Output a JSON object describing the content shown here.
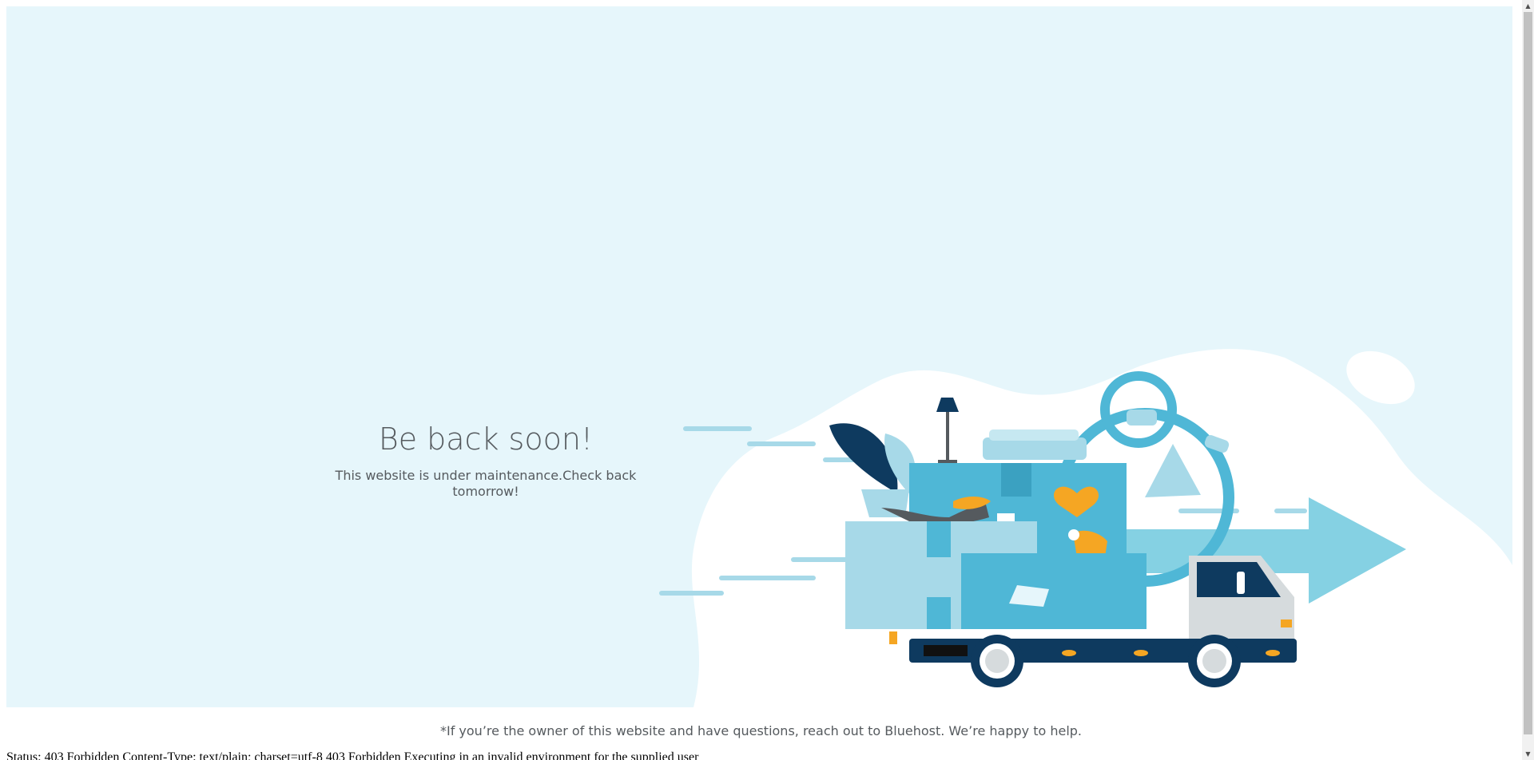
{
  "hero": {
    "title": "Be back soon!",
    "subtitle": "This website is under maintenance.Check back tomorrow!"
  },
  "footer": {
    "note": "*If you’re the owner of this website and have questions, reach out to Bluehost. We’re happy to help."
  },
  "status": {
    "text": "Status: 403 Forbidden Content-Type: text/plain; charset=utf-8 403 Forbidden Executing in an invalid environment for the supplied user"
  },
  "colors": {
    "hero_bg": "#e6f6fb",
    "text": "#555a5e",
    "light_blue": "#a7d9e8",
    "mid_blue": "#4fb7d6",
    "dark_navy": "#0e3a5f",
    "accent_orange": "#f5a623"
  },
  "icons": {
    "scroll_up": "▲",
    "scroll_down": "▼"
  }
}
